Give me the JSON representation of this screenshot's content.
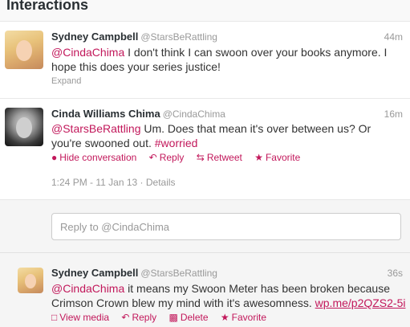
{
  "header": {
    "title": "Interactions"
  },
  "tweets": [
    {
      "name": "Sydney Campbell",
      "handle": "@StarsBeRattling",
      "time": "44m",
      "mention": "@CindaChima",
      "text_line1": " I don't think I can swoon over your books anymore. I",
      "text_line2": "hope this does your series justice!",
      "expand": "Expand"
    },
    {
      "name": "Cinda Williams Chima",
      "handle": "@CindaChima",
      "time": "16m",
      "mention": "@StarsBeRattling",
      "text_line1": " Um. Does that mean it's over between us? Or",
      "text_line2": "you're swooned out. ",
      "hashtag": "#worried",
      "actions": {
        "hide": "Hide conversation",
        "reply": "Reply",
        "retweet": "Retweet",
        "favorite": "Favorite"
      },
      "timestamp": "1:24 PM - 11 Jan 13",
      "separator": " · ",
      "details": "Details"
    },
    {
      "name": "Sydney Campbell",
      "handle": "@StarsBeRattling",
      "time": "36s",
      "mention": "@CindaChima",
      "text_line1": " it means my Swoon Meter has been broken because",
      "text_line2": "Crimson Crown blew my mind with it's awesomness. ",
      "link": "wp.me/p2QZS2-5i",
      "actions": {
        "view_media": "View media",
        "reply": "Reply",
        "delete": "Delete",
        "favorite": "Favorite"
      }
    }
  ],
  "reply": {
    "placeholder": "Reply to @CindaChima"
  },
  "icons": {
    "reply": "reply-arrow-icon",
    "retweet": "retweet-icon",
    "favorite": "star-icon",
    "hide": "speech-bubble-icon",
    "media": "document-icon",
    "delete": "trash-icon"
  },
  "colors": {
    "accent": "#c2185b",
    "muted": "#999999"
  }
}
